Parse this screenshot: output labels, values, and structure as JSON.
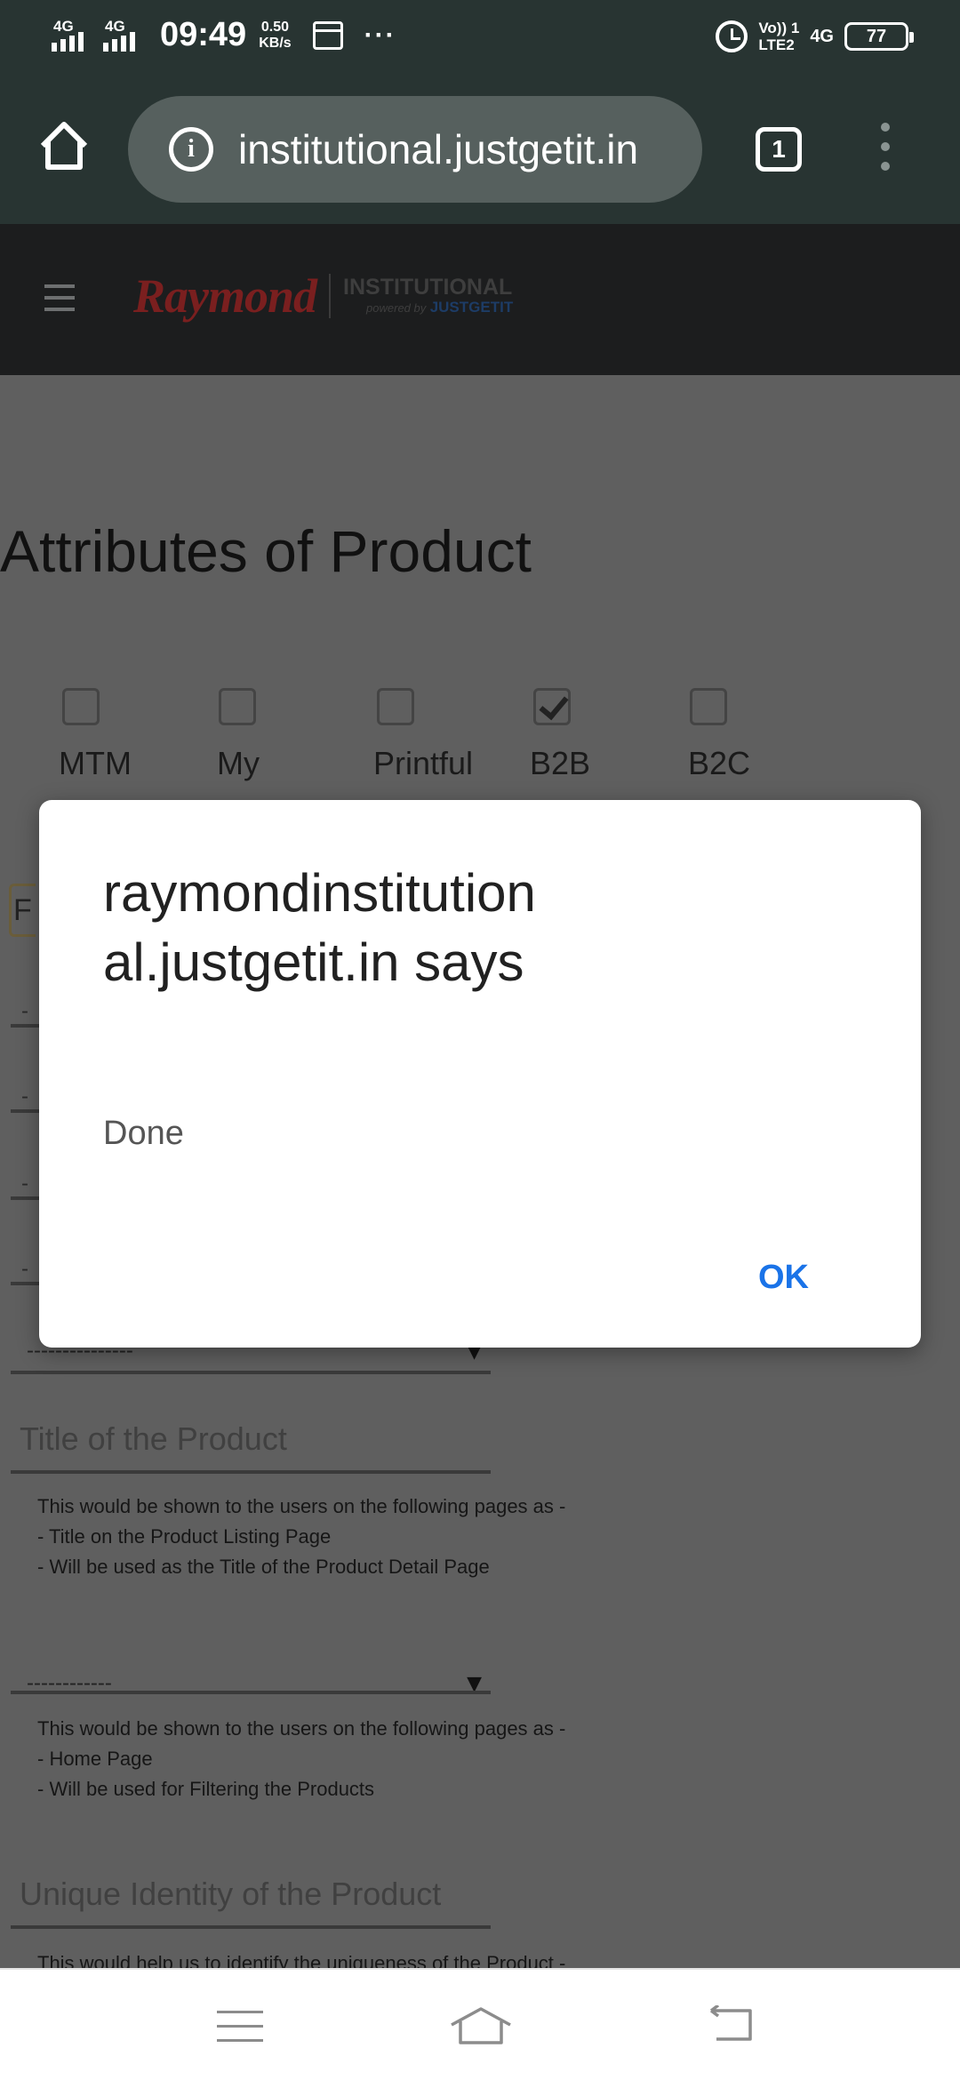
{
  "status_bar": {
    "network_1": "4G",
    "network_2": "4G",
    "time": "09:49",
    "speed_value": "0.50",
    "speed_unit": "KB/s",
    "more": "···",
    "volte_line1": "Vo)) 1",
    "volte_line2": "LTE2",
    "network_3": "4G",
    "battery": "77"
  },
  "browser": {
    "url": "institutional.justgetit.in",
    "tab_count": "1"
  },
  "site_header": {
    "logo_main": "Raymond",
    "logo_sub": "INSTITUTIONAL",
    "logo_powered": "powered by",
    "logo_brand": "JUSTGETIT"
  },
  "page": {
    "title": "Attributes of Product",
    "checkboxes": [
      {
        "label": "MTM",
        "checked": false
      },
      {
        "label": "My",
        "checked": false
      },
      {
        "label": "Printful",
        "checked": false
      },
      {
        "label": "B2B",
        "checked": true
      },
      {
        "label": "B2C",
        "checked": false
      }
    ],
    "hidden_tab_text": "F",
    "dash": "-",
    "select_1_value": "---------------",
    "select_arrow": "▼",
    "title_field": {
      "placeholder": "Title of the Product",
      "help": [
        "This would be shown to the users on the following pages as -",
        "- Title on the Product Listing Page",
        "- Will be used as the Title of the Product Detail Page"
      ]
    },
    "select_2_value": "------------",
    "select_2_help": [
      "This would be shown to the users on the following pages as -",
      "- Home Page",
      "- Will be used for Filtering the Products"
    ],
    "unique_field": {
      "placeholder": "Unique Identity of the Product",
      "help": "This would help us to identify the uniqueness of the Product -"
    }
  },
  "dialog": {
    "title": "raymondinstitutional.justgetit.in says",
    "message": "Done",
    "ok_label": "OK"
  }
}
